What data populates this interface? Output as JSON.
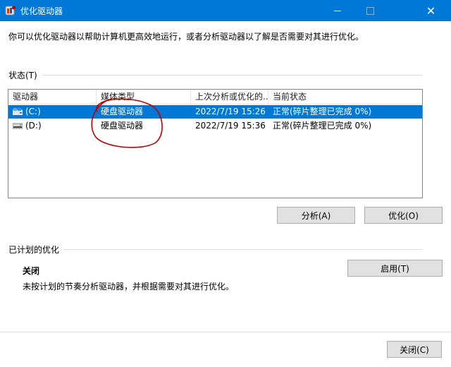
{
  "window": {
    "title": "优化驱动器"
  },
  "description": "你可以优化驱动器以帮助计算机更高效地运行，或者分析驱动器以了解是否需要对其进行优化。",
  "status_section": {
    "label": "状态(T)",
    "columns": [
      "驱动器",
      "媒体类型",
      "上次分析或优化的...",
      "当前状态"
    ],
    "drives": [
      {
        "drive": "(C:)",
        "media": "硬盘驱动器",
        "last_run": "2022/7/19 15:26",
        "status": "正常(碎片整理已完成 0%)",
        "selected": true,
        "icon": "system-drive-icon"
      },
      {
        "drive": "(D:)",
        "media": "硬盘驱动器",
        "last_run": "2022/7/19 15:36",
        "status": "正常(碎片整理已完成 0%)",
        "selected": false,
        "icon": "hard-drive-icon"
      }
    ],
    "analyze_label": "分析(A)",
    "optimize_label": "优化(O)"
  },
  "schedule_section": {
    "label": "已计划的优化",
    "status": "关闭",
    "description": "未按计划的节奏分析驱动器，并根据需要对其进行优化。",
    "enable_label": "启用(T)"
  },
  "close_label": "关闭(C)",
  "colors": {
    "titlebar": "#0078d7",
    "selection": "#0078d7",
    "annotation": "#c00000"
  }
}
